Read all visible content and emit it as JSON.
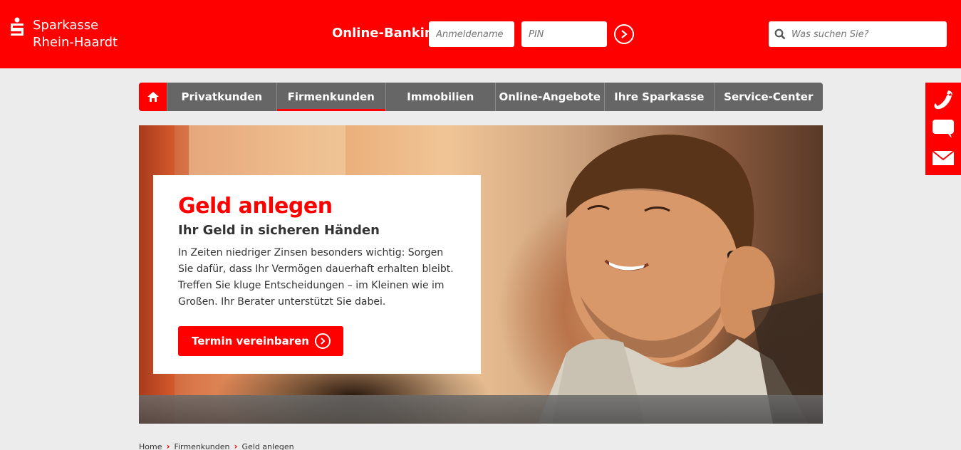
{
  "brand": {
    "line1": "Sparkasse",
    "line2": "Rhein-Haardt",
    "accent": "#ff0000"
  },
  "login": {
    "label": "Online-Banking",
    "username_placeholder": "Anmeldename",
    "pin_placeholder": "PIN",
    "submit_icon": "chevron-right-circle-icon"
  },
  "search": {
    "placeholder": "Was suchen Sie?",
    "icon": "search-icon"
  },
  "nav": {
    "home_icon": "home-icon",
    "items": [
      {
        "label": "Privatkunden"
      },
      {
        "label": "Firmenkunden",
        "active": true
      },
      {
        "label": "Immobilien"
      },
      {
        "label": "Online-Angebote"
      },
      {
        "label": "Ihre Sparkasse"
      },
      {
        "label": "Service-Center"
      }
    ]
  },
  "contact_bar": {
    "icons": [
      "phone-icon",
      "chat-icon",
      "mail-icon"
    ]
  },
  "hero": {
    "title": "Geld anlegen",
    "subtitle": "Ihr Geld in sicheren Händen",
    "body": "In Zeiten niedriger Zinsen besonders wichtig: Sorgen Sie dafür, dass Ihr Vermögen dauerhaft erhalten bleibt. Treffen Sie kluge Entscheidungen – im Kleinen wie im Großen. Ihr Berater unterstützt Sie dabei.",
    "cta_label": "Termin vereinbaren"
  },
  "breadcrumb": [
    "Home",
    "Firmenkunden",
    "Geld anlegen"
  ]
}
